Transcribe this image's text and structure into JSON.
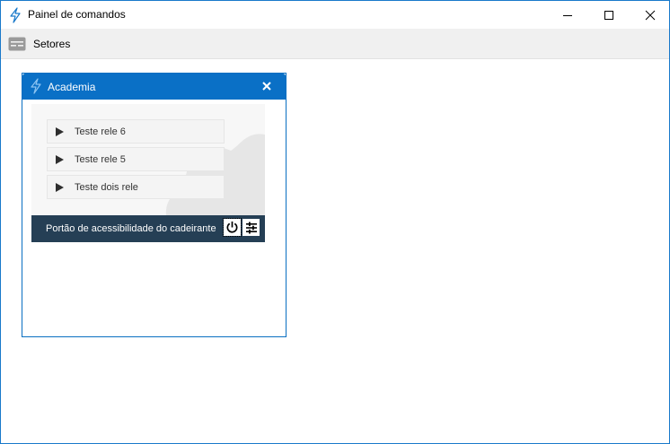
{
  "window": {
    "title": "Painel de comandos",
    "icon": "lightning-bolt-icon",
    "accent_color": "#0a70c6"
  },
  "toolbar": {
    "items": [
      {
        "label": "Setores",
        "icon": "sectors-icon"
      }
    ]
  },
  "panel": {
    "title": "Academia",
    "icon": "lightning-bolt-icon",
    "relays": [
      {
        "label": "Teste rele 6",
        "icon": "play-icon"
      },
      {
        "label": "Teste rele 5",
        "icon": "play-icon"
      },
      {
        "label": "Teste dois rele",
        "icon": "play-icon"
      }
    ],
    "device": {
      "label": "Portão de acessibilidade do cadeirante",
      "power_icon": "power-icon",
      "settings_icon": "sliders-icon",
      "bar_color": "#253f55"
    }
  }
}
